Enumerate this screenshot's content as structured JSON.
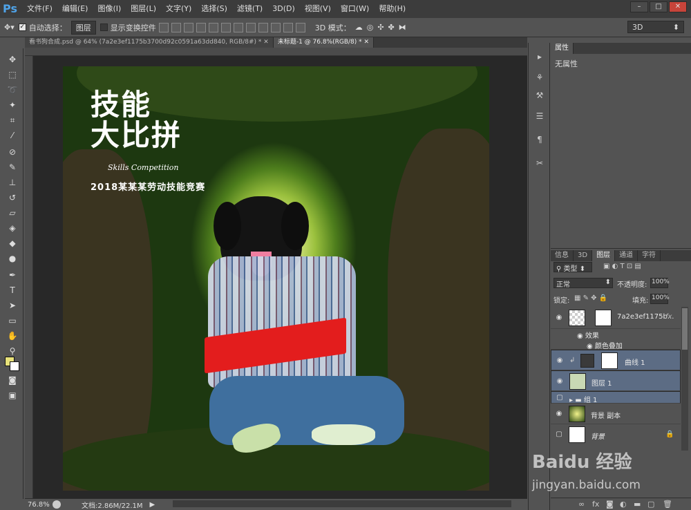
{
  "menubar": {
    "logo": "Ps",
    "items": [
      "文件(F)",
      "编辑(E)",
      "图像(I)",
      "图层(L)",
      "文字(Y)",
      "选择(S)",
      "滤镜(T)",
      "3D(D)",
      "视图(V)",
      "窗口(W)",
      "帮助(H)"
    ]
  },
  "options": {
    "auto_select_label": "自动选择：",
    "auto_select_target": "图层",
    "show_transform_label": "显示变换控件",
    "mode3d_label": "3D 模式：",
    "workspace": "3D"
  },
  "tabs": [
    {
      "label": "看书狗合成.psd @ 64% (7a2e3ef1175b3700d92c0591a63dd840, RGB/8#) *",
      "active": false
    },
    {
      "label": "未标题-1 @ 76.8%(RGB/8) *",
      "active": true
    }
  ],
  "poster": {
    "title_line1": "技能",
    "title_line2": "大比拼",
    "subtitle": "Skills Competition",
    "headline": "2018某某某劳动技能竞赛"
  },
  "statusbar": {
    "zoom": "76.8%",
    "doc_size": "文档:2.86M/22.1M"
  },
  "properties": {
    "tab": "属性",
    "empty_text": "无属性"
  },
  "layers": {
    "tabs": [
      "信息",
      "3D",
      "图层",
      "通道",
      "字符"
    ],
    "active_tab": "图层",
    "filter_kind": "类型",
    "blend_mode": "正常",
    "opacity_label": "不透明度:",
    "opacity_value": "100%",
    "lock_label": "锁定:",
    "fill_label": "填充:",
    "fill_value": "100%",
    "items": [
      {
        "name": "7a2e3ef1175b...",
        "fx": "fx"
      },
      {
        "name": "效果"
      },
      {
        "name": "颜色叠加"
      },
      {
        "name": "曲线 1"
      },
      {
        "name": "图层 1"
      },
      {
        "name": "组 1"
      },
      {
        "name": "背景 副本"
      },
      {
        "name": "背景"
      }
    ]
  },
  "watermark": {
    "brand": "Baidu 经验",
    "url": "jingyan.baidu.com"
  },
  "colors": {
    "foreground": "#e8e27a",
    "background": "#ffffff",
    "accent": "#4fa3e8"
  }
}
